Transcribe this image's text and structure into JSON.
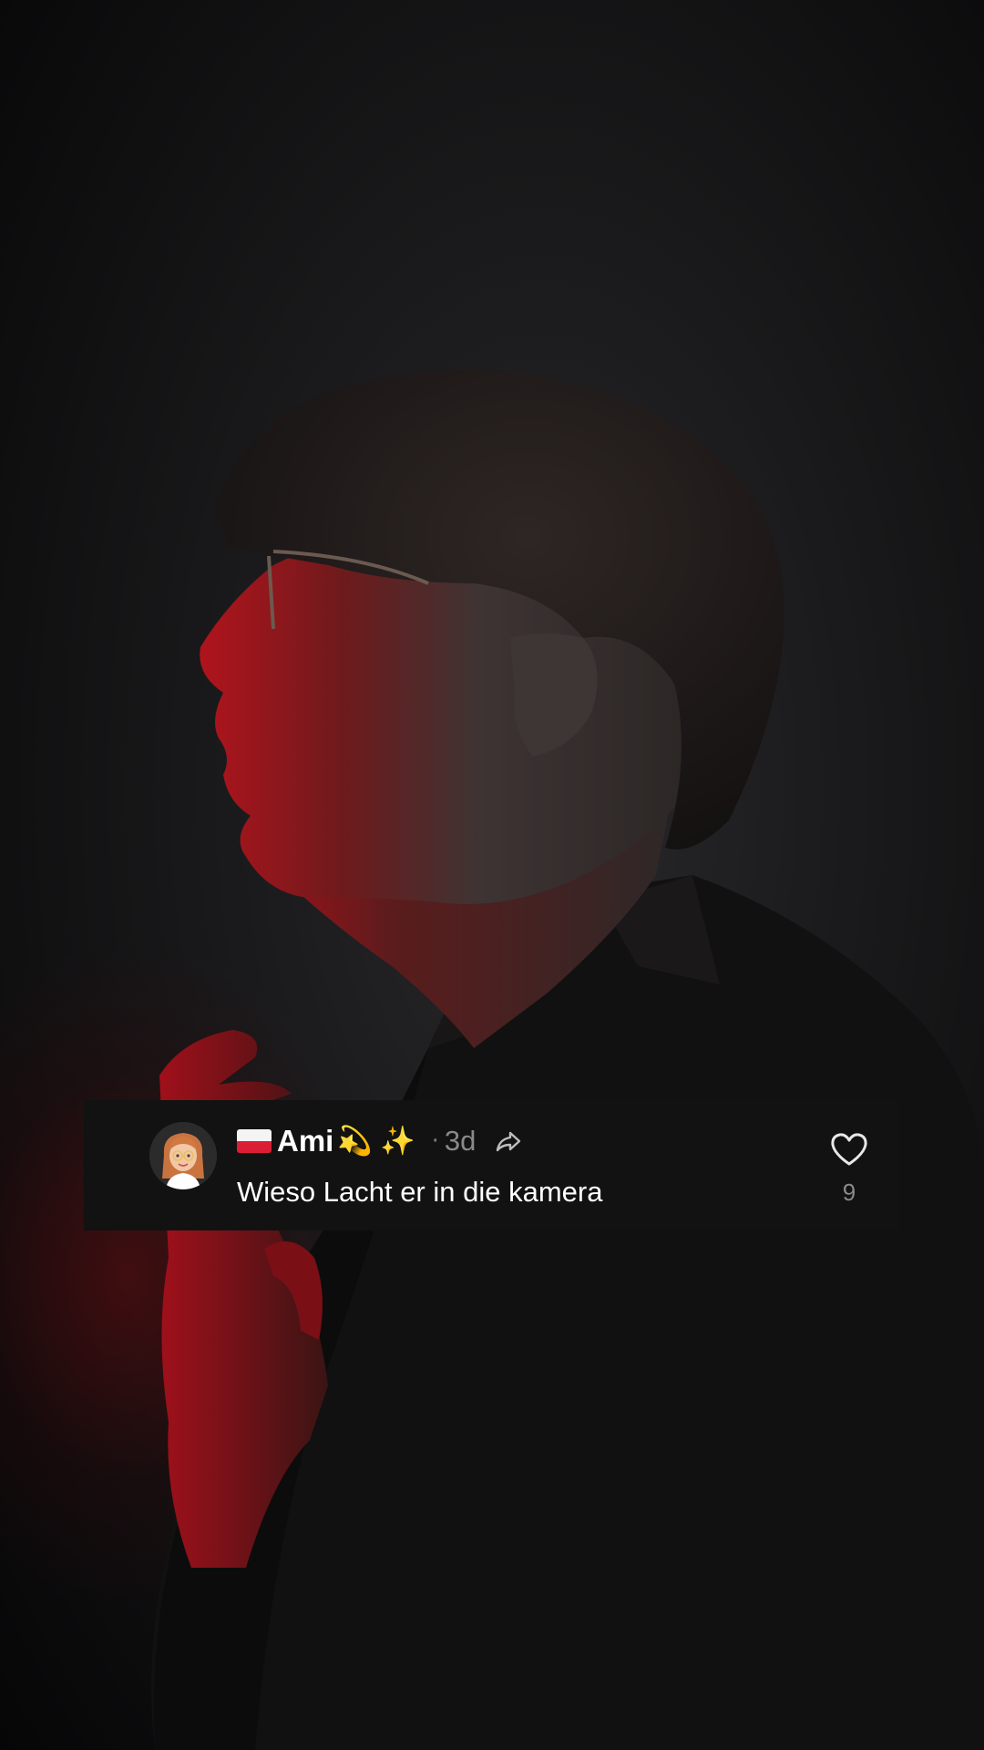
{
  "comment": {
    "flag": "poland-flag",
    "username": "Ami",
    "emoji_1": "💫",
    "emoji_2": "✨",
    "separator": "·",
    "time": "3d",
    "text": "Wieso Lacht er in die kamera",
    "like_count": "9"
  },
  "icons": {
    "share": "share-arrow-icon",
    "like": "heart-outline-icon",
    "avatar": "memoji-avatar"
  },
  "colors": {
    "card_background": "#121212",
    "text_primary": "#ffffff",
    "text_secondary": "#8a8a8a",
    "flag_white": "#f4f4f4",
    "flag_red": "#dc1e35",
    "accent_red_light": "#c4121b"
  }
}
